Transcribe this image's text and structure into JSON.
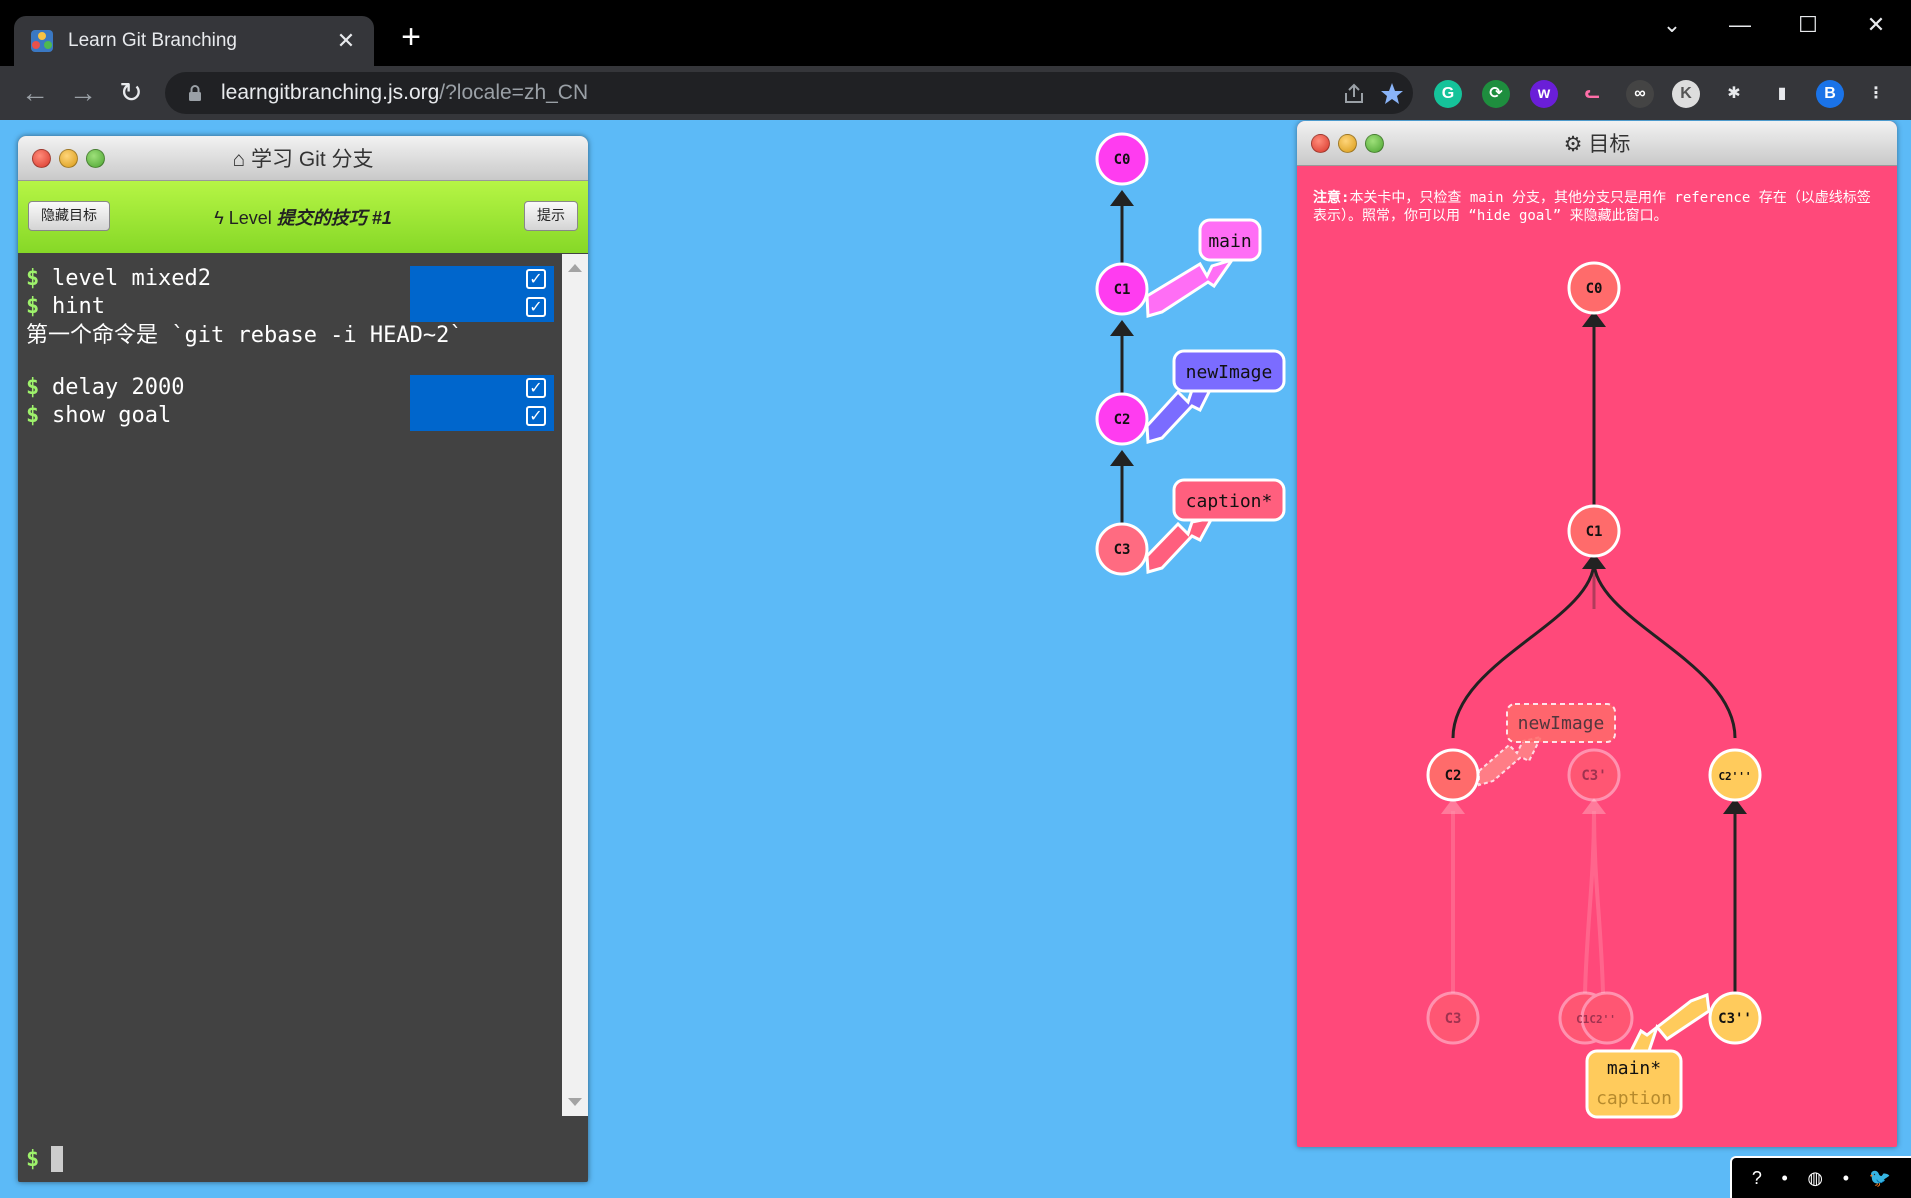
{
  "browser": {
    "tab_title": "Learn Git Branching",
    "new_tab": "+",
    "url_host": "learngitbranching.js.org",
    "url_path": "/?locale=zh_CN",
    "profile_initial": "B",
    "window_controls": {
      "minimize": "—",
      "maximize": "☐",
      "close": "✕",
      "tab_search": "⌄"
    }
  },
  "command_window": {
    "title": "学习 Git 分支",
    "hide_goal_button": "隐藏目标",
    "hint_button": "提示",
    "level_prefix": "Level",
    "level_name": "提交的技巧 #1",
    "commands": [
      {
        "text": "level mixed2"
      },
      {
        "text": "hint"
      },
      {
        "text": "delay 2000"
      },
      {
        "text": "show goal"
      }
    ],
    "prompt": "$",
    "hint_text": "第一个命令是 `git rebase -i HEAD~2`"
  },
  "main_graph": {
    "commits": [
      "C0",
      "C1",
      "C2",
      "C3"
    ],
    "branches": [
      "main",
      "newImage",
      "caption*"
    ],
    "colors": {
      "node": "#ff3cf0",
      "main": "#ff6ef5",
      "newImage": "#7b6cff",
      "caption": "#ff5f7e"
    }
  },
  "goal_window": {
    "title": "目标",
    "note_label": "注意:",
    "note_text": "本关卡中，只检查 main 分支，其他分支只是用作 reference 存在（以虚线标签表示）。照常，你可以用 “hide goal” 来隐藏此窗口。",
    "commits": {
      "c0": "C0",
      "c1": "C1",
      "c2": "C2",
      "c3p": "C3'",
      "c2ppp": "C2'''",
      "c3": "C3",
      "c1c2": "C1C2''",
      "c3pp": "C3''"
    },
    "branches": {
      "newImage": "newImage",
      "main": "main*",
      "caption": "caption"
    },
    "colors": {
      "bg": "#ff497a",
      "node": "#ff6b6b",
      "accent": "#ffcb5c"
    }
  },
  "footer": {
    "help_icon": "?",
    "globe_icon": "◍",
    "twitter_icon": "🐦",
    "separator": "•"
  }
}
